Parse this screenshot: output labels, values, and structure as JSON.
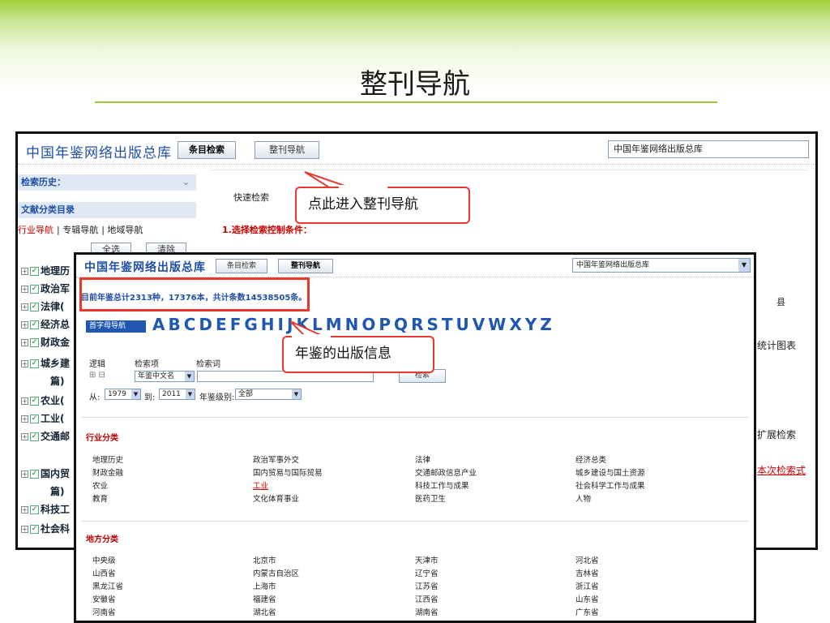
{
  "slide": {
    "title": "整刊导航"
  },
  "back": {
    "brand": "中国年鉴网络出版总库",
    "btn_item_search": "条目检索",
    "btn_journal_nav": "整刊导航",
    "db_select": "中国年鉴网络出版总库",
    "sidebar": {
      "history_label": "检索历史：",
      "catalog_label": "文献分类目录",
      "tabs": [
        "行业导航",
        "专辑导航",
        "地域导航"
      ],
      "btn_all": "全选",
      "btn_clear": "清除",
      "categories": [
        "地理历",
        "政治军",
        "法律(",
        "经济总",
        "财政金",
        "城乡建",
        "篇)",
        "农业(",
        "工业(",
        "交通邮",
        "国内贸",
        "篇)",
        "科技工",
        "社会科"
      ]
    },
    "main": {
      "tab_quick": "快速检索",
      "step1": "1.选择检索控制条件：",
      "right_county": "县",
      "right_stats": "统计图表",
      "right_expand": "扩展检索",
      "right_this": "本次检索式"
    }
  },
  "front": {
    "brand": "中国年鉴网络出版总库",
    "btn_item_search": "条目检索",
    "btn_journal_nav": "整刊导航",
    "db_select": "中国年鉴网络出版总库",
    "info": "目前年鉴总计2313种，17376本，共计条数14538505条。",
    "alpha_nav_label": "首字母导航",
    "letters": [
      "A",
      "B",
      "C",
      "D",
      "E",
      "F",
      "G",
      "H",
      "I",
      "J",
      "K",
      "L",
      "M",
      "N",
      "O",
      "P",
      "Q",
      "R",
      "S",
      "T",
      "U",
      "V",
      "W",
      "X",
      "Y",
      "Z"
    ],
    "search": {
      "logic_label": "逻辑",
      "item_label": "检索项",
      "word_label": "检索词",
      "item_value": "年鉴中文名",
      "from_label": "从:",
      "from_value": "1979",
      "to_label": "到:",
      "to_value": "2011",
      "level_label": "年鉴级别:",
      "level_value": "全部",
      "btn_search": "检索"
    },
    "industry_head": "行业分类",
    "industry": [
      [
        "地理历史",
        "政治军事外交",
        "法律",
        "经济总类"
      ],
      [
        "财政金融",
        "国内贸易与国际贸易",
        "交通邮政信息产业",
        "城乡建设与国土资源"
      ],
      [
        "农业",
        "工业",
        "科技工作与成果",
        "社会科学工作与成果"
      ],
      [
        "教育",
        "文化体育事业",
        "医药卫生",
        "人物"
      ]
    ],
    "region_head": "地方分类",
    "region": [
      [
        "中央级",
        "北京市",
        "天津市",
        "河北省"
      ],
      [
        "山西省",
        "内蒙古自治区",
        "辽宁省",
        "吉林省"
      ],
      [
        "黑龙江省",
        "上海市",
        "江苏省",
        "浙江省"
      ],
      [
        "安徽省",
        "福建省",
        "江西省",
        "山东省"
      ],
      [
        "河南省",
        "湖北省",
        "湖南省",
        "广东省"
      ]
    ]
  },
  "callouts": {
    "journal_nav": "点此进入整刊导航",
    "publish_info": "年鉴的出版信息"
  },
  "colors": {
    "accent_green": "#9bc934",
    "callout_red": "#e8392e",
    "brand_blue": "#1f4fa8"
  }
}
